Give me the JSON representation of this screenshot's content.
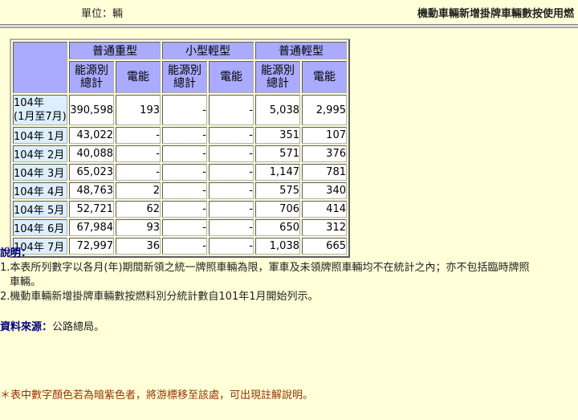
{
  "header": {
    "unit": "單位：輛",
    "title": "機動車輛新增掛牌車輛數按使用燃"
  },
  "table": {
    "groups": [
      "普通重型",
      "小型輕型",
      "普通輕型"
    ],
    "sub_headers": {
      "total": "能源別總計",
      "electric": "電能"
    },
    "rows": [
      {
        "label": "104年\n(1月至7月)",
        "values": [
          "390,598",
          "193",
          "-",
          "-",
          "5,038",
          "2,995"
        ]
      },
      {
        "label": "104年 1月",
        "values": [
          "43,022",
          "-",
          "-",
          "-",
          "351",
          "107"
        ]
      },
      {
        "label": "104年 2月",
        "values": [
          "40,088",
          "-",
          "-",
          "-",
          "571",
          "376"
        ]
      },
      {
        "label": "104年 3月",
        "values": [
          "65,023",
          "-",
          "-",
          "-",
          "1,147",
          "781"
        ]
      },
      {
        "label": "104年 4月",
        "values": [
          "48,763",
          "2",
          "-",
          "-",
          "575",
          "340"
        ]
      },
      {
        "label": "104年 5月",
        "values": [
          "52,721",
          "62",
          "-",
          "-",
          "706",
          "414"
        ]
      },
      {
        "label": "104年 6月",
        "values": [
          "67,984",
          "93",
          "-",
          "-",
          "650",
          "312"
        ]
      },
      {
        "label": "104年 7月",
        "values": [
          "72,997",
          "36",
          "-",
          "-",
          "1,038",
          "665"
        ]
      }
    ]
  },
  "notes": {
    "title": "說明：",
    "lines": [
      "1.本表所列數字以各月(年)期間新領之統一牌照車輛為限，軍車及未領牌照車輛均不在統計之內；亦不包括臨時牌照",
      "   車輛。",
      "2.機動車輛新增掛牌車輛數按燃料別分統計數自101年1月開始列示。"
    ]
  },
  "source": {
    "label": "資料來源：",
    "text": "公路總局。"
  },
  "hint": "＊表中數字顏色若為暗紫色者，將游標移至該處，可出現註解說明。",
  "colors": {
    "background": "#ffffd8",
    "header_cell": "#aaaaff",
    "row_label_cell": "#ddeeff",
    "data_cell": "#ffffff",
    "hint_text": "#993300"
  }
}
